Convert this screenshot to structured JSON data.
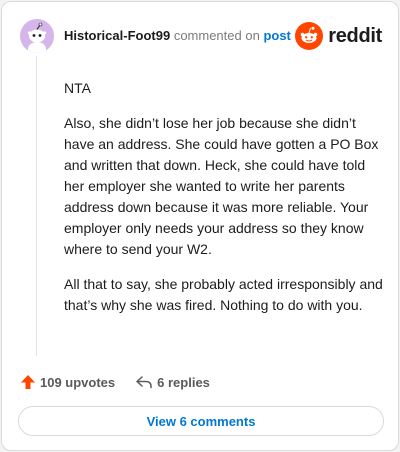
{
  "header": {
    "username": "Historical-Foot99",
    "action_text": "commented on",
    "target_link": "post",
    "brand_name": "reddit",
    "avatar_icon": "snoo-avatar-icon",
    "brand_icon": "reddit-logo-icon"
  },
  "comment": {
    "paragraphs": [
      "NTA",
      "Also, she didn’t lose her job because she didn’t have an address. She could have gotten a PO Box and written that down. Heck, she could have told her employer she wanted to write her parents address down because it was more reliable. Your employer only needs your address so they know where to send your W2.",
      "All that to say, she probably acted irresponsibly and that’s why she was fired. Nothing to do with you."
    ]
  },
  "actions": {
    "upvotes_label": "109 upvotes",
    "replies_label": "6 replies",
    "upvote_icon": "upvote-arrow-icon",
    "reply_icon": "reply-arrow-icon"
  },
  "footer": {
    "view_comments_label": "View 6 comments"
  },
  "colors": {
    "accent_blue": "#0079d3",
    "reddit_orange": "#ff4500",
    "avatar_bg": "#d6b6ea"
  }
}
